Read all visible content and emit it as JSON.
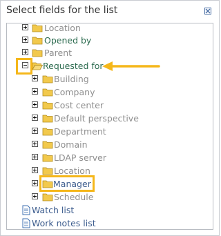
{
  "dialog": {
    "title": "Select fields for the list"
  },
  "tree": {
    "items": [
      {
        "label": "Location",
        "expander": "plus",
        "icon": "folder-icon",
        "style": "gray"
      },
      {
        "label": "Opened by",
        "expander": "plus",
        "icon": "folder-icon",
        "style": "green"
      },
      {
        "label": "Parent",
        "expander": "plus",
        "icon": "folder-icon",
        "style": "gray"
      },
      {
        "label": "Requested for",
        "expander": "minus",
        "icon": "open-folder-icon",
        "style": "green",
        "highlighted": true
      },
      {
        "label": "Building",
        "expander": "plus",
        "icon": "folder-icon",
        "style": "gray"
      },
      {
        "label": "Company",
        "expander": "plus",
        "icon": "folder-icon",
        "style": "gray"
      },
      {
        "label": "Cost center",
        "expander": "plus",
        "icon": "folder-icon",
        "style": "gray"
      },
      {
        "label": "Default perspective",
        "expander": "plus",
        "icon": "folder-icon",
        "style": "gray"
      },
      {
        "label": "Department",
        "expander": "plus",
        "icon": "folder-icon",
        "style": "gray"
      },
      {
        "label": "Domain",
        "expander": "plus",
        "icon": "folder-icon",
        "style": "gray"
      },
      {
        "label": "LDAP server",
        "expander": "plus",
        "icon": "folder-icon",
        "style": "gray"
      },
      {
        "label": "Location",
        "expander": "plus",
        "icon": "folder-icon",
        "style": "gray"
      },
      {
        "label": "Manager",
        "expander": "plus",
        "icon": "folder-icon",
        "style": "blue",
        "highlighted": true
      },
      {
        "label": "Schedule",
        "expander": "plus",
        "icon": "folder-icon",
        "style": "gray"
      },
      {
        "label": "Watch list",
        "icon": "document-icon",
        "style": "blue"
      },
      {
        "label": "Work notes list",
        "icon": "document-icon",
        "style": "blue"
      }
    ]
  },
  "colors": {
    "highlight": "#f5b71a",
    "green_text": "#2c6b4f",
    "gray_text": "#8f8f8f",
    "blue_text": "#3d5d8e"
  }
}
